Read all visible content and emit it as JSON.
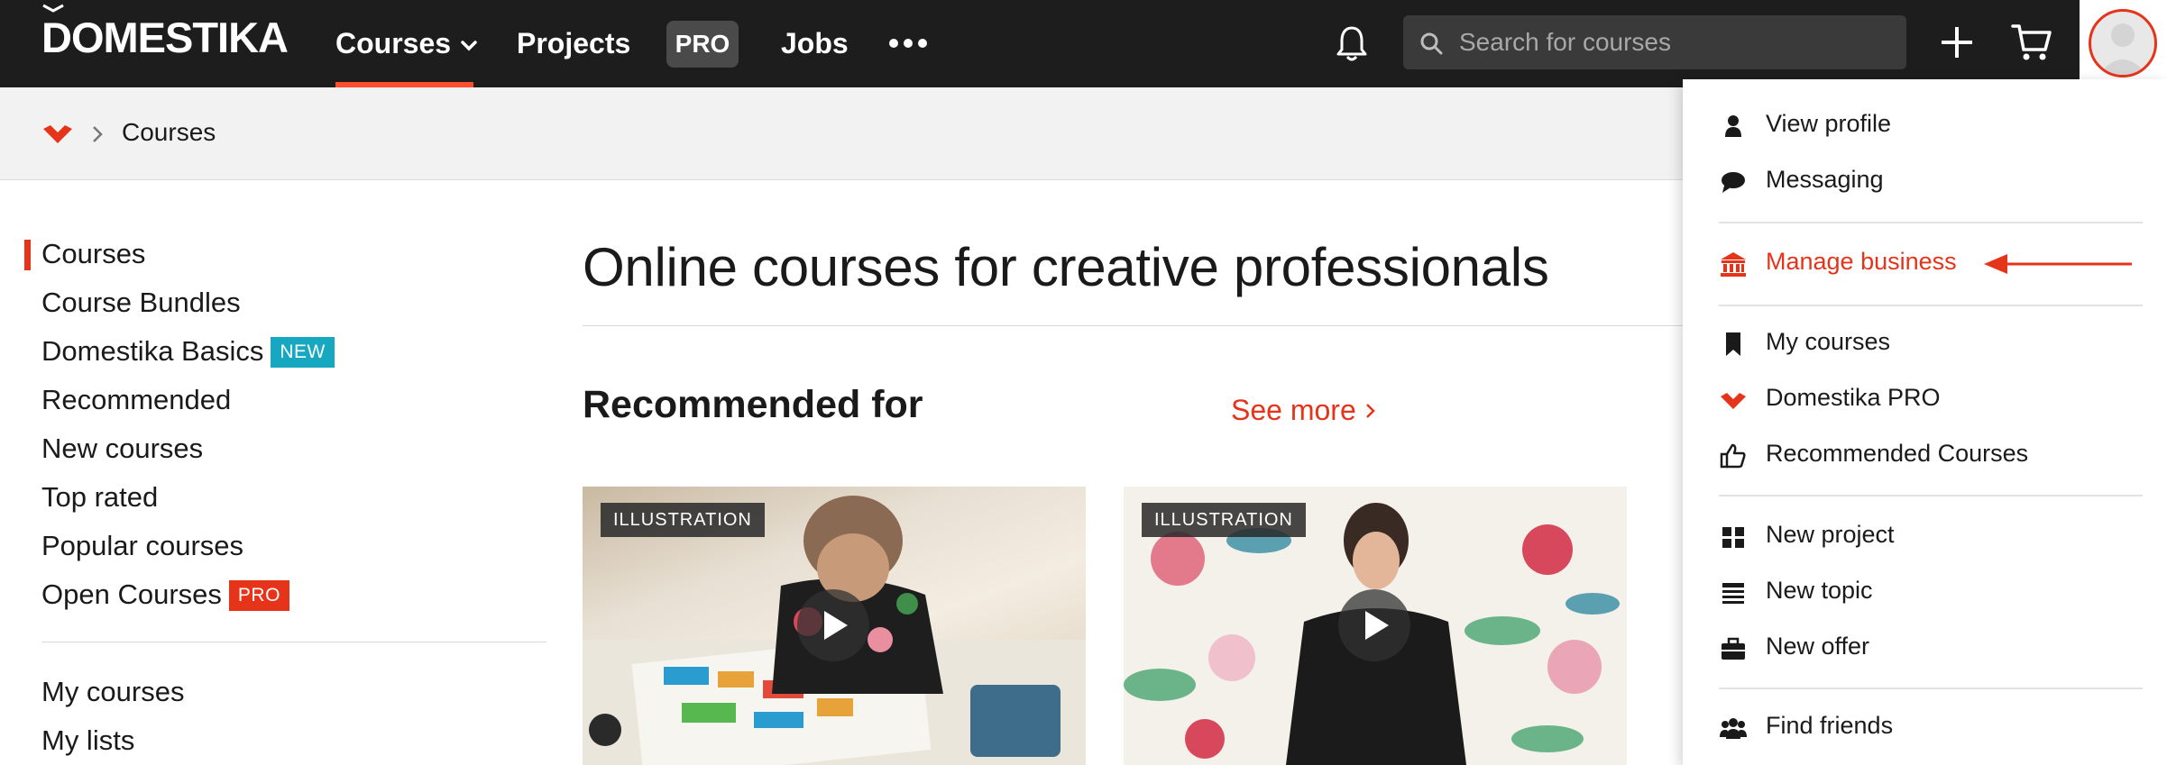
{
  "topnav": {
    "logo": "DOMESTIKA",
    "courses_label": "Courses",
    "projects_label": "Projects",
    "pro_label": "PRO",
    "jobs_label": "Jobs",
    "search_placeholder": "Search for courses"
  },
  "breadcrumb": {
    "current": "Courses"
  },
  "sidebar": {
    "items": [
      {
        "label": "Courses",
        "active": true
      },
      {
        "label": "Course Bundles"
      },
      {
        "label": "Domestika Basics",
        "badge": "NEW"
      },
      {
        "label": "Recommended"
      },
      {
        "label": "New courses"
      },
      {
        "label": "Top rated"
      },
      {
        "label": "Popular courses"
      },
      {
        "label": "Open Courses",
        "badge": "PRO"
      },
      {
        "label": "My courses"
      },
      {
        "label": "My lists"
      }
    ]
  },
  "main": {
    "title": "Online courses for creative professionals",
    "section_title": "Recommended for",
    "see_more": "See more",
    "cards": [
      {
        "tag": "ILLUSTRATION"
      },
      {
        "tag": "ILLUSTRATION"
      }
    ]
  },
  "dropdown": {
    "items": [
      {
        "label": "View profile",
        "icon": "user-icon"
      },
      {
        "label": "Messaging",
        "icon": "speech-bubble-icon"
      },
      {
        "label": "Manage business",
        "icon": "bank-icon",
        "highlight": true
      },
      {
        "label": "My courses",
        "icon": "bookmark-icon"
      },
      {
        "label": "Domestika PRO",
        "icon": "domestika-logo-icon"
      },
      {
        "label": "Recommended Courses",
        "icon": "thumbs-up-icon"
      },
      {
        "label": "New project",
        "icon": "grid-icon"
      },
      {
        "label": "New topic",
        "icon": "topic-icon"
      },
      {
        "label": "New offer",
        "icon": "briefcase-icon"
      },
      {
        "label": "Find friends",
        "icon": "users-icon"
      }
    ]
  },
  "colors": {
    "accent": "#e5341a",
    "nav_bg": "#1d1d1d",
    "new_badge": "#16a8c0"
  }
}
